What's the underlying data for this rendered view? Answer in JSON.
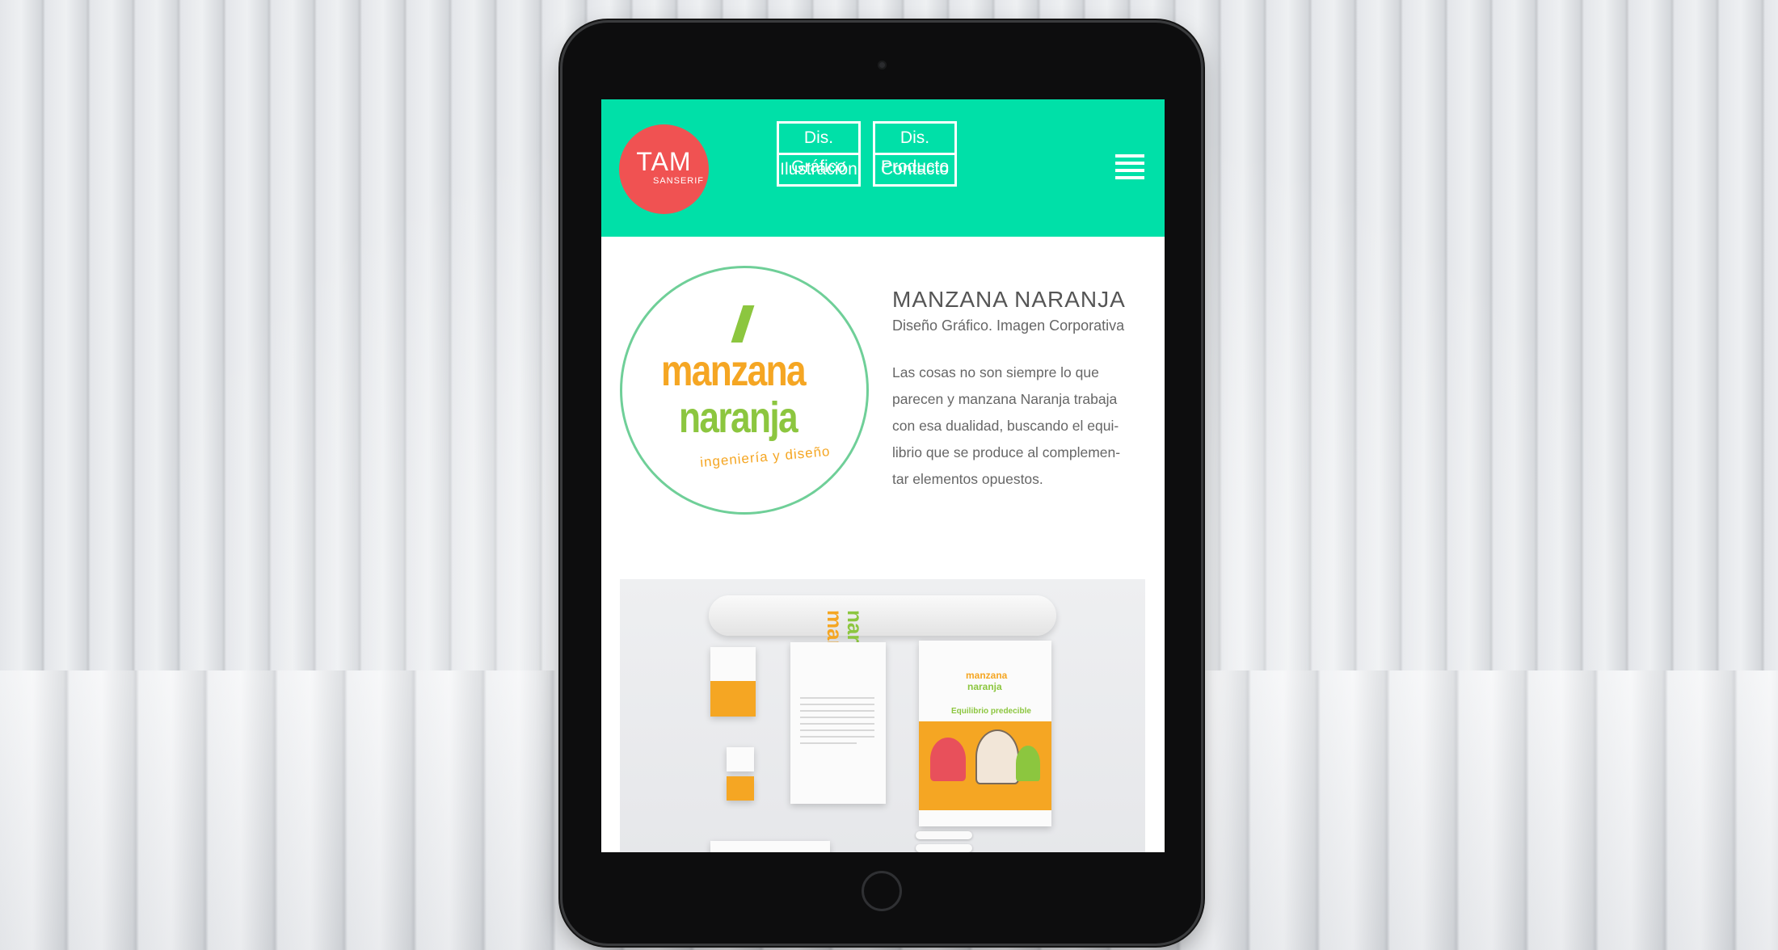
{
  "site": {
    "logo": {
      "main": "TAM",
      "sub": "SANSERIF"
    },
    "nav": [
      {
        "label": "Dis. Gráfico"
      },
      {
        "label": "Dis. Producto"
      },
      {
        "label": "Ilustración"
      },
      {
        "label": "Contacto"
      }
    ],
    "menu_icon": "hamburger-menu-icon"
  },
  "project": {
    "logo": {
      "word1": "manzana",
      "word2": "naranja",
      "tagline": "ingeniería y diseño"
    },
    "title": "MANZANA NARANJA",
    "subtitle": "Diseño Gráfico. Imagen Corporativa",
    "description_lines": [
      "Las cosas no son siempre lo que",
      "parecen y manzana Naranja trabaja",
      "con esa dualidad, buscando el equi-",
      "librio que se produce al complemen-",
      "tar elementos opuestos."
    ],
    "mockup": {
      "roll_word1": "manzan",
      "roll_word2": "naran",
      "folder_word1": "manzana",
      "folder_word2": "naranja",
      "folder_tagline": "Equilibrio predecible"
    }
  },
  "colors": {
    "header": "#00e0a8",
    "logo_circle": "#f05252",
    "orange": "#f5a623",
    "green": "#8cc63f",
    "circle_border": "#6fcf98"
  }
}
